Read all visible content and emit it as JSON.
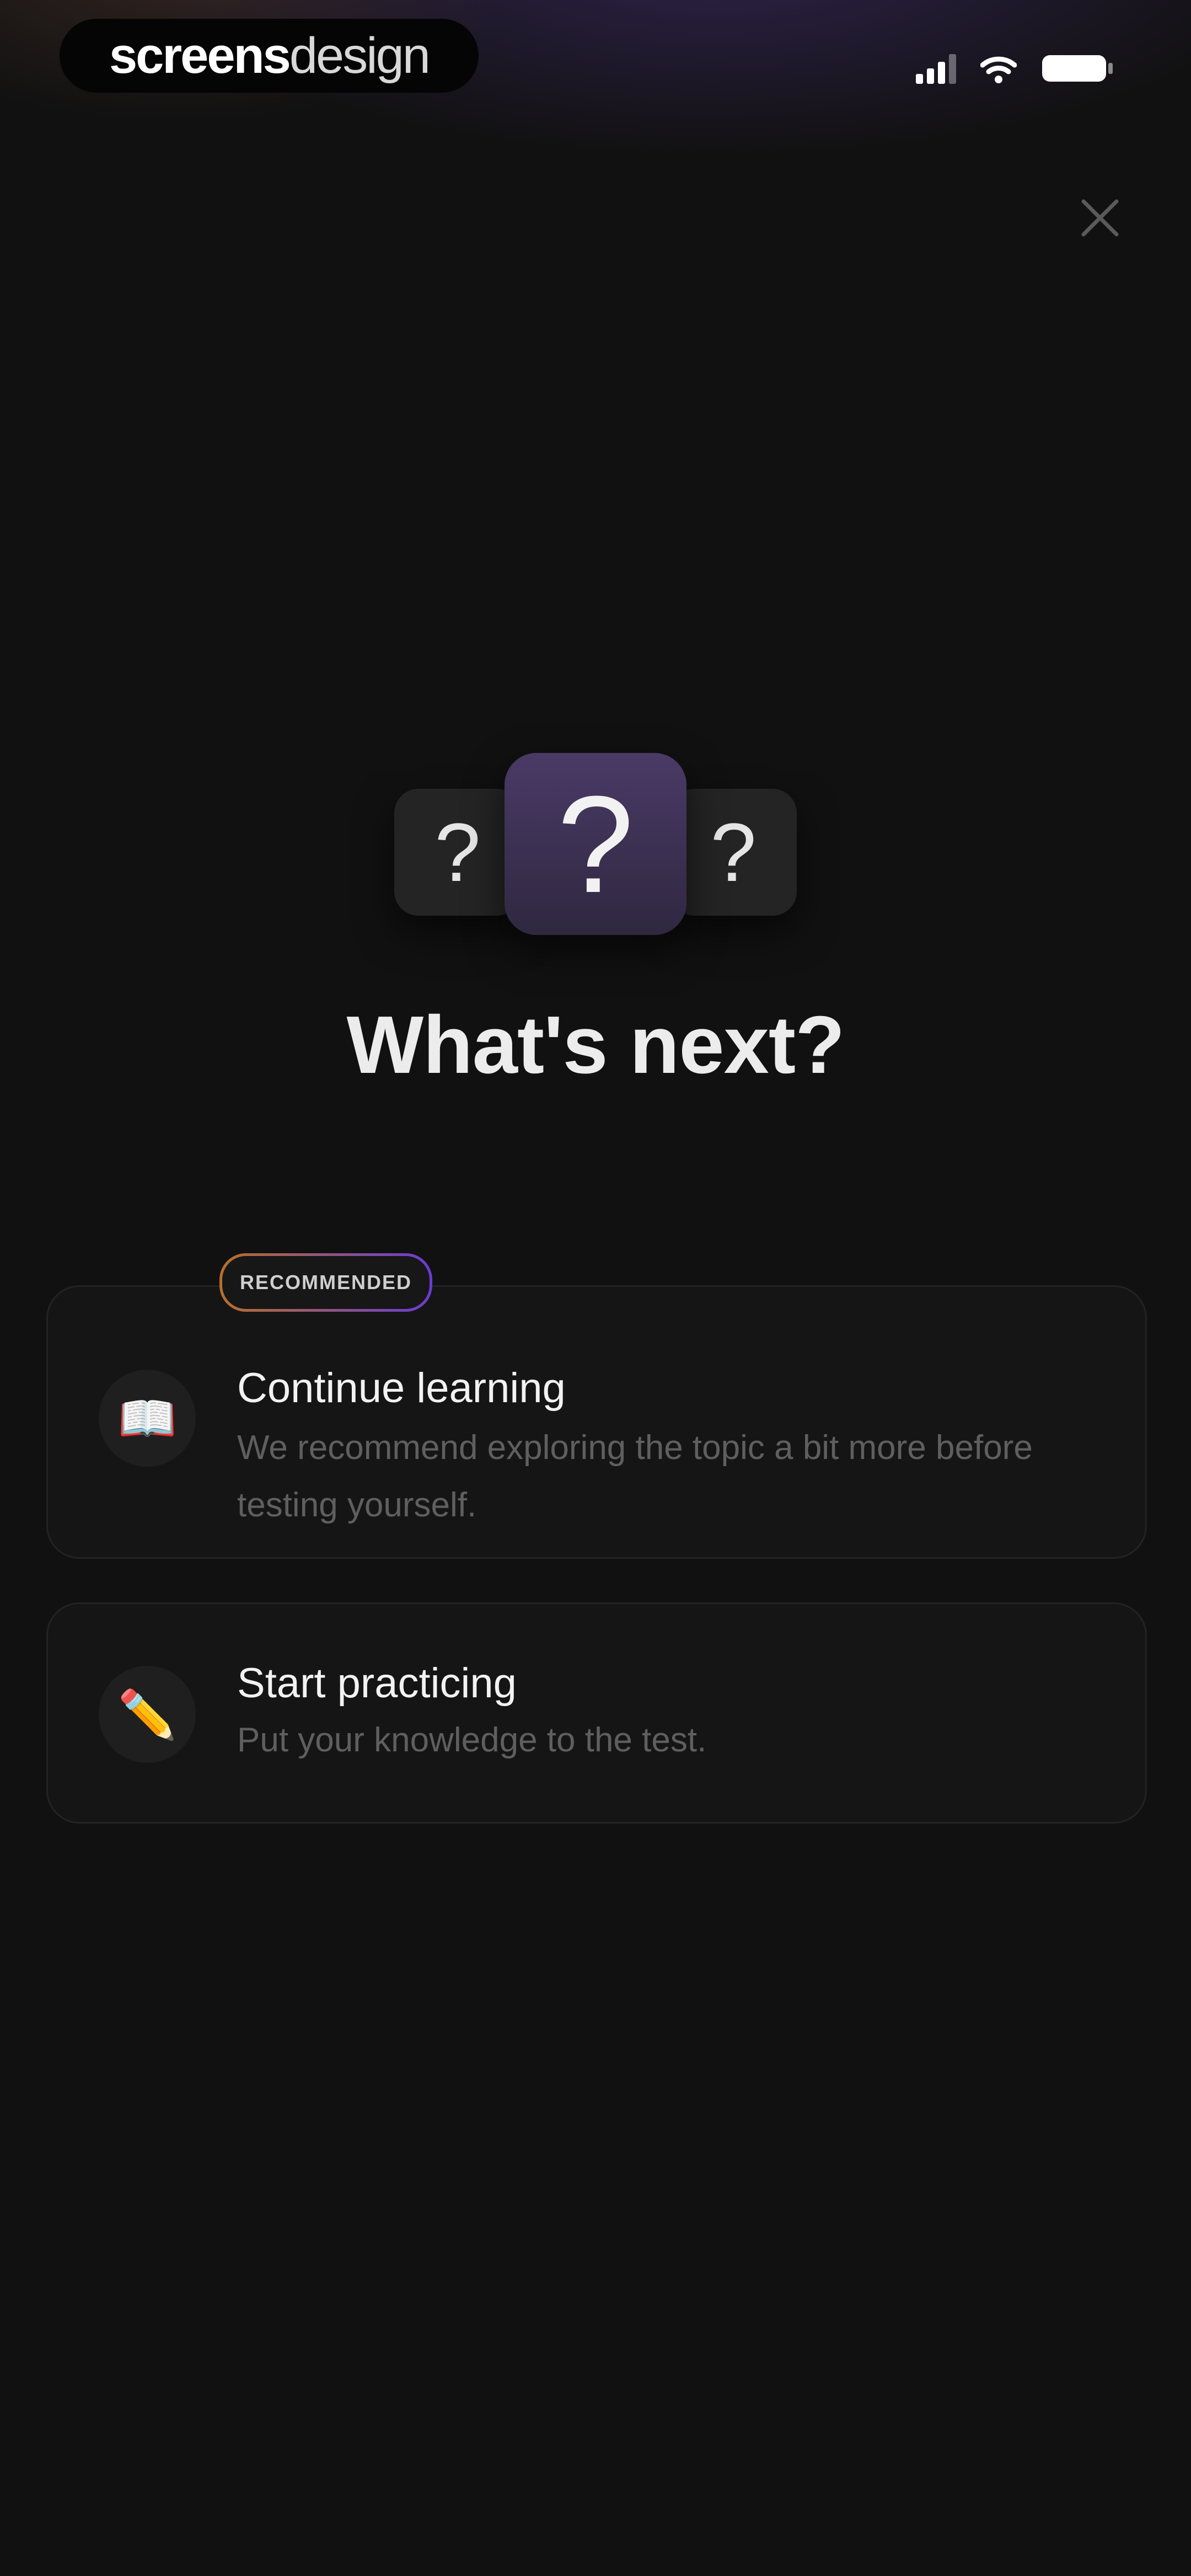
{
  "status_bar": {
    "brand_part1": "screens",
    "brand_part2": "design",
    "signal_icon": "signal-icon",
    "wifi_icon": "wifi-icon",
    "battery_icon": "battery-icon"
  },
  "close": {
    "icon": "close-icon"
  },
  "illustration": {
    "left_glyph": "?",
    "center_glyph": "?",
    "right_glyph": "?"
  },
  "page_title": "What's next?",
  "options": [
    {
      "badge": "RECOMMENDED",
      "icon_glyph": "📖",
      "icon_name": "book-icon",
      "title": "Continue learning",
      "description": "We recommend exploring the topic a bit more before testing yourself."
    },
    {
      "icon_glyph": "✏️",
      "icon_name": "pencil-icon",
      "title": "Start practicing",
      "description": "Put your knowledge to the test."
    }
  ],
  "colors": {
    "background": "#111111",
    "card": "#151515",
    "badge_gradient_start": "#b8702a",
    "badge_gradient_end": "#6a3bd6",
    "center_card": "#4a3a66"
  }
}
